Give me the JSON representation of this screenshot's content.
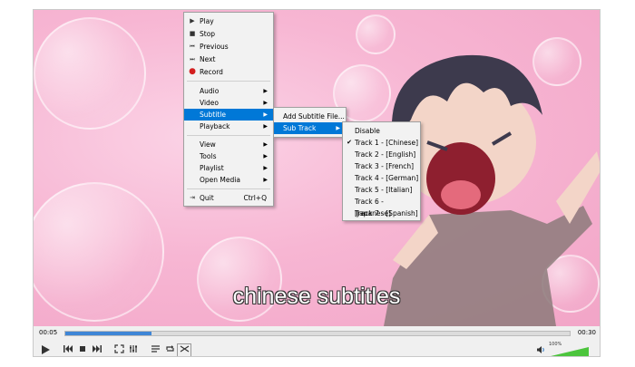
{
  "player": {
    "subtitle_text": "chinese subtitles",
    "elapsed": "00:05",
    "duration": "00:30",
    "progress_fraction": 0.17,
    "volume_label": "100%",
    "volume_fraction": 1.0,
    "accent_color": "#0078d7"
  },
  "menu": {
    "play": "Play",
    "stop": "Stop",
    "previous": "Previous",
    "next": "Next",
    "record": "Record",
    "audio": "Audio",
    "video": "Video",
    "subtitle": "Subtitle",
    "playback": "Playback",
    "view": "View",
    "tools": "Tools",
    "playlist": "Playlist",
    "open_media": "Open Media",
    "quit": "Quit",
    "quit_shortcut": "Ctrl+Q"
  },
  "subtitle_menu": {
    "add_file": "Add Subtitle File...",
    "sub_track": "Sub Track"
  },
  "track_menu": {
    "disable": "Disable",
    "tracks": [
      "Track 1 - [Chinese]",
      "Track 2 - [English]",
      "Track 3 - [French]",
      "Track 4 - [German]",
      "Track 5 - [Italian]",
      "Track 6 - [Japanese]",
      "Track 7 - [Spanish]"
    ],
    "checked_index": 0
  },
  "icons": {
    "play": "play-icon",
    "stop": "stop-icon",
    "previous": "previous-icon",
    "next": "next-icon",
    "record": "record-icon",
    "quit": "quit-icon"
  }
}
